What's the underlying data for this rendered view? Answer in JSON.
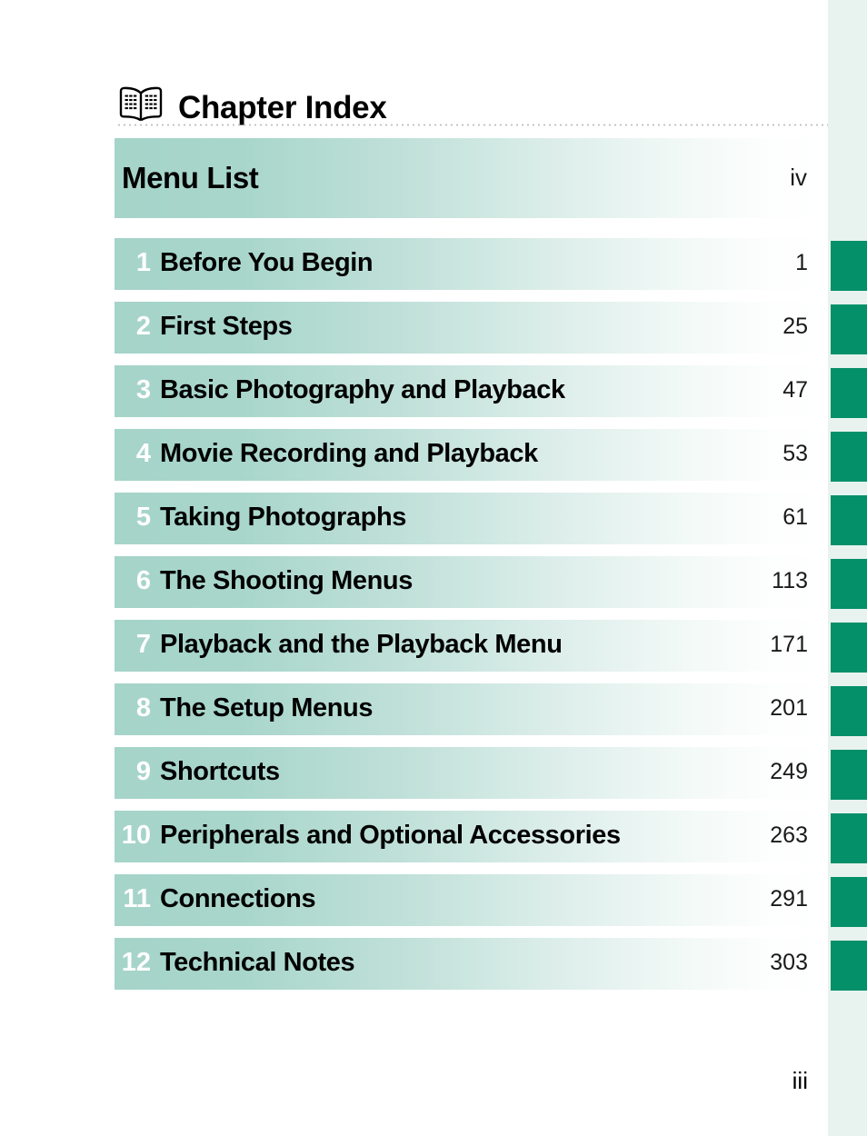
{
  "header": {
    "icon": "open-book-icon",
    "title": "Chapter Index"
  },
  "colors": {
    "tab_green": "#049069",
    "tab_strip_background": "#e8f2ef",
    "row_gradient_start": "#a5d4c9",
    "row_gradient_end": "#ffffff",
    "title_text": "#000000",
    "number_text": "#ffffff"
  },
  "index": {
    "front_matter": [
      {
        "number": "",
        "title": "Menu List",
        "page": "iv"
      }
    ],
    "chapters": [
      {
        "number": "1",
        "title": "Before You Begin",
        "page": "1"
      },
      {
        "number": "2",
        "title": "First Steps",
        "page": "25"
      },
      {
        "number": "3",
        "title": "Basic Photography and Playback",
        "page": "47"
      },
      {
        "number": "4",
        "title": "Movie Recording and Playback",
        "page": "53"
      },
      {
        "number": "5",
        "title": "Taking Photographs",
        "page": "61"
      },
      {
        "number": "6",
        "title": "The Shooting Menus",
        "page": "113"
      },
      {
        "number": "7",
        "title": "Playback and the Playback Menu",
        "page": "171"
      },
      {
        "number": "8",
        "title": "The Setup Menus",
        "page": "201"
      },
      {
        "number": "9",
        "title": "Shortcuts",
        "page": "249"
      },
      {
        "number": "10",
        "title": "Peripherals and Optional Accessories",
        "page": "263"
      },
      {
        "number": "11",
        "title": "Connections",
        "page": "291"
      },
      {
        "number": "12",
        "title": "Technical Notes",
        "page": "303"
      }
    ]
  },
  "tab_strip": {
    "count": 12
  },
  "footer": {
    "folio": "iii"
  }
}
